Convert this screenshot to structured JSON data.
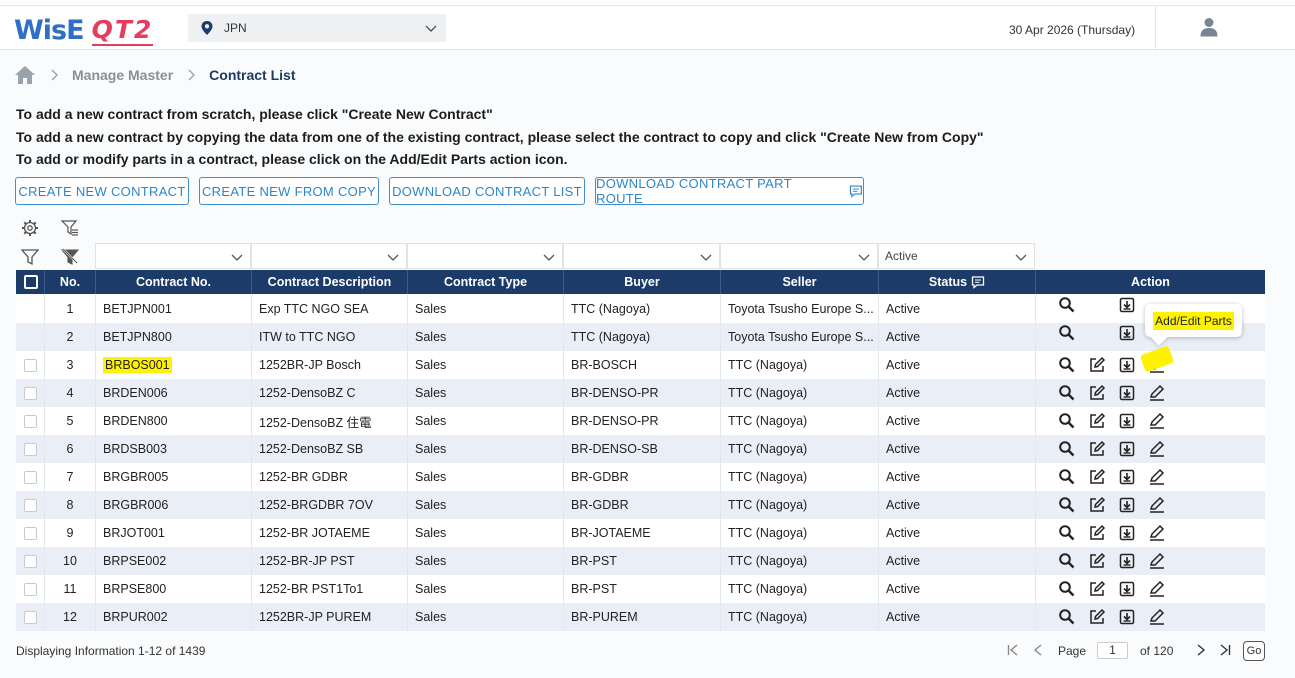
{
  "header": {
    "logo_part1": "WisE",
    "logo_part2": "QT2",
    "country": "JPN",
    "date": "30 Apr 2026 (Thursday)"
  },
  "breadcrumb": {
    "items": [
      "Manage Master",
      "Contract List"
    ]
  },
  "instructions": [
    "To add a new contract from scratch, please click \"Create New Contract\"",
    "To add a new contract by copying the data from one of the existing contract, please select the contract to copy and click \"Create New from Copy\"",
    "To add or modify parts in a contract, please click on the Add/Edit Parts action icon."
  ],
  "buttons": {
    "create_new": "CREATE NEW CONTRACT",
    "create_copy": "CREATE NEW FROM COPY",
    "download_list": "DOWNLOAD CONTRACT LIST",
    "download_route": "DOWNLOAD CONTRACT PART ROUTE"
  },
  "filters": {
    "status": "Active"
  },
  "table": {
    "headers": [
      "No.",
      "Contract No.",
      "Contract Description",
      "Contract Type",
      "Buyer",
      "Seller",
      "Status",
      "Action"
    ],
    "rows": [
      {
        "no": "1",
        "contract_no": "BETJPN001",
        "desc": "Exp TTC NGO SEA",
        "type": "Sales",
        "buyer": "TTC (Nagoya)",
        "seller": "Toyota Tsusho Europe S...",
        "status": "Active"
      },
      {
        "no": "2",
        "contract_no": "BETJPN800",
        "desc": "ITW to TTC NGO",
        "type": "Sales",
        "buyer": "TTC (Nagoya)",
        "seller": "Toyota Tsusho Europe S...",
        "status": "Active"
      },
      {
        "no": "3",
        "contract_no": "BRBOS001",
        "desc": "1252BR-JP Bosch",
        "type": "Sales",
        "buyer": "BR-BOSCH",
        "seller": "TTC (Nagoya)",
        "status": "Active"
      },
      {
        "no": "4",
        "contract_no": "BRDEN006",
        "desc": "1252-DensoBZ C",
        "type": "Sales",
        "buyer": "BR-DENSO-PR",
        "seller": "TTC (Nagoya)",
        "status": "Active"
      },
      {
        "no": "5",
        "contract_no": "BRDEN800",
        "desc": "1252-DensoBZ 住電",
        "type": "Sales",
        "buyer": "BR-DENSO-PR",
        "seller": "TTC (Nagoya)",
        "status": "Active"
      },
      {
        "no": "6",
        "contract_no": "BRDSB003",
        "desc": "1252-DensoBZ SB",
        "type": "Sales",
        "buyer": "BR-DENSO-SB",
        "seller": "TTC (Nagoya)",
        "status": "Active"
      },
      {
        "no": "7",
        "contract_no": "BRGBR005",
        "desc": "1252-BR GDBR",
        "type": "Sales",
        "buyer": "BR-GDBR",
        "seller": "TTC (Nagoya)",
        "status": "Active"
      },
      {
        "no": "8",
        "contract_no": "BRGBR006",
        "desc": "1252-BRGDBR 7OV",
        "type": "Sales",
        "buyer": "BR-GDBR",
        "seller": "TTC (Nagoya)",
        "status": "Active"
      },
      {
        "no": "9",
        "contract_no": "BRJOT001",
        "desc": "1252-BR JOTAEME",
        "type": "Sales",
        "buyer": "BR-JOTAEME",
        "seller": "TTC (Nagoya)",
        "status": "Active"
      },
      {
        "no": "10",
        "contract_no": "BRPSE002",
        "desc": "1252-BR-JP PST",
        "type": "Sales",
        "buyer": "BR-PST",
        "seller": "TTC (Nagoya)",
        "status": "Active"
      },
      {
        "no": "11",
        "contract_no": "BRPSE800",
        "desc": "1252-BR PST1To1",
        "type": "Sales",
        "buyer": "BR-PST",
        "seller": "TTC (Nagoya)",
        "status": "Active"
      },
      {
        "no": "12",
        "contract_no": "BRPUR002",
        "desc": "1252BR-JP PUREM",
        "type": "Sales",
        "buyer": "BR-PUREM",
        "seller": "TTC (Nagoya)",
        "status": "Active"
      }
    ]
  },
  "tooltip": "Add/Edit Parts",
  "footer": {
    "info": "Displaying Information 1-12 of 1439",
    "page_label": "Page",
    "page_value": "1",
    "of_label": "of 120",
    "go_label": "Go"
  },
  "colors": {
    "header_bg": "#1d3b69",
    "accent": "#2e86c9",
    "highlight": "#fff200"
  }
}
